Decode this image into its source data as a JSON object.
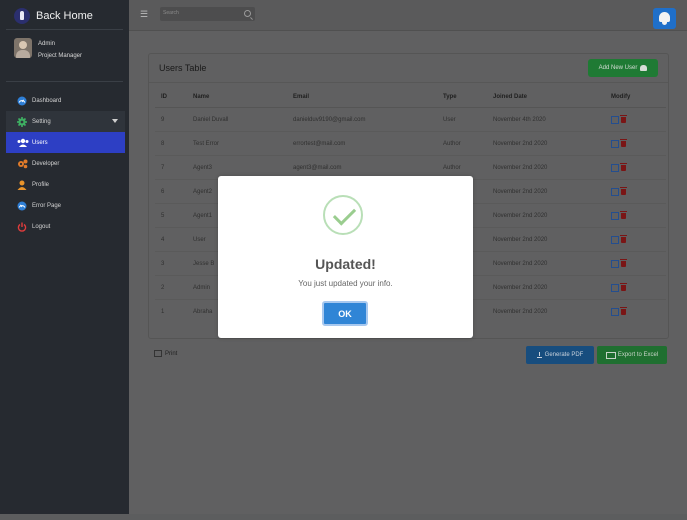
{
  "sidebar": {
    "brand": "Back Home",
    "user": {
      "name": "Admin",
      "role": "Project Manager"
    },
    "nav": [
      {
        "label": "Dashboard",
        "icon": "dashboard-icon"
      },
      {
        "label": "Setting",
        "icon": "gear-icon"
      },
      {
        "label": "Users",
        "icon": "users-icon"
      },
      {
        "label": "Developer",
        "icon": "cogs-icon"
      },
      {
        "label": "Profile",
        "icon": "user-icon"
      },
      {
        "label": "Error Page",
        "icon": "gauge-icon"
      },
      {
        "label": "Logout",
        "icon": "power-icon"
      }
    ]
  },
  "topbar": {
    "search_placeholder": "Search"
  },
  "card": {
    "title": "Users Table",
    "add_button": "Add New User",
    "columns": [
      "ID",
      "Name",
      "Email",
      "Type",
      "Joined Date",
      "Modify"
    ],
    "rows": [
      {
        "id": "9",
        "name": "Daniel Duvall",
        "email": "danielduv9190@gmail.com",
        "type": "User",
        "joined": "November 4th 2020"
      },
      {
        "id": "8",
        "name": "Test Error",
        "email": "errortest@mail.com",
        "type": "Author",
        "joined": "November 2nd 2020"
      },
      {
        "id": "7",
        "name": "Agent3",
        "email": "agent3@mail.com",
        "type": "Author",
        "joined": "November 2nd 2020"
      },
      {
        "id": "6",
        "name": "Agent2",
        "email": "",
        "type": "",
        "joined": "November 2nd 2020"
      },
      {
        "id": "5",
        "name": "Agent1",
        "email": "",
        "type": "",
        "joined": "November 2nd 2020"
      },
      {
        "id": "4",
        "name": "User",
        "email": "",
        "type": "",
        "joined": "November 2nd 2020"
      },
      {
        "id": "3",
        "name": "Jesse B",
        "email": "",
        "type": "",
        "joined": "November 2nd 2020"
      },
      {
        "id": "2",
        "name": "Admin",
        "email": "",
        "type": "",
        "joined": "November 2nd 2020"
      },
      {
        "id": "1",
        "name": "Abraha",
        "email": "",
        "type": "",
        "joined": "November 2nd 2020"
      }
    ],
    "print": "Print",
    "pdf_button": "Generate PDF",
    "excel_button": "Export to Excel"
  },
  "modal": {
    "title": "Updated!",
    "message": "You just updated your info.",
    "ok": "OK"
  },
  "colors": {
    "sidebar_bg": "#262a30",
    "active_nav": "#2d3fc4",
    "ok_button": "#3085d6",
    "success_check": "#9acd8f"
  }
}
